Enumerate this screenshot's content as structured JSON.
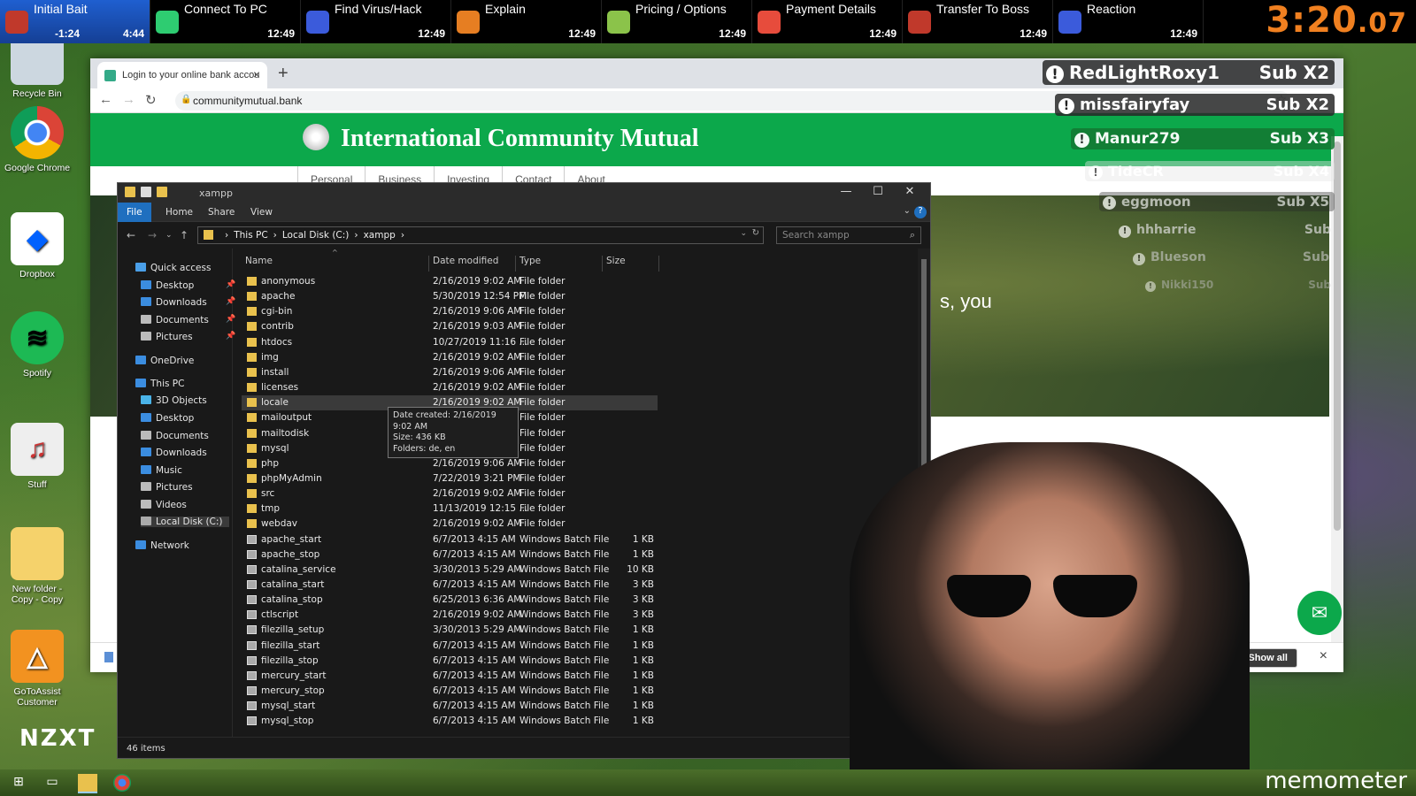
{
  "splits": [
    {
      "name": "Initial Bait",
      "delta": "-1:24",
      "time": "4:44",
      "active": true,
      "color": "#c0392b"
    },
    {
      "name": "Connect To PC",
      "time": "12:49",
      "color": "#2ecc71"
    },
    {
      "name": "Find Virus/Hack",
      "time": "12:49",
      "color": "#3b5bdb"
    },
    {
      "name": "Explain",
      "time": "12:49",
      "color": "#e67e22"
    },
    {
      "name": "Pricing / Options",
      "time": "12:49",
      "color": "#8bc34a"
    },
    {
      "name": "Payment Details",
      "time": "12:49",
      "color": "#e74c3c"
    },
    {
      "name": "Transfer To Boss",
      "time": "12:49",
      "color": "#c0392b"
    },
    {
      "name": "Reaction",
      "time": "12:49",
      "color": "#3b5bdb"
    }
  ],
  "timer": {
    "main": "3:20",
    "frac": ".07"
  },
  "desktop_icons": [
    {
      "label": "Recycle Bin"
    },
    {
      "label": "Google Chrome"
    },
    {
      "label": "Dropbox"
    },
    {
      "label": "Spotify"
    },
    {
      "label": "Stuff"
    },
    {
      "label": "New folder - Copy - Copy"
    },
    {
      "label": "GoToAssist Customer"
    }
  ],
  "nzxt": "NZXT",
  "browser": {
    "tab_title": "Login to your online bank accou",
    "url": "communitymutual.bank",
    "site_title": "International Community Mutual",
    "nav": [
      "Personal",
      "Business",
      "Investing",
      "Contact",
      "About"
    ],
    "hero_text": "s, you",
    "show_all": "Show all"
  },
  "explorer": {
    "title": "xampp",
    "ribbon": [
      "File",
      "Home",
      "Share",
      "View"
    ],
    "path": [
      "This PC",
      "Local Disk (C:)",
      "xampp"
    ],
    "search_placeholder": "Search xampp",
    "nav_pane": [
      {
        "label": "Quick access",
        "icon": "star-icon",
        "level": 0
      },
      {
        "label": "Desktop",
        "icon": "desktop-icon",
        "level": 1,
        "pinned": true
      },
      {
        "label": "Downloads",
        "icon": "download-icon",
        "level": 1,
        "pinned": true
      },
      {
        "label": "Documents",
        "icon": "documents-icon",
        "level": 1,
        "pinned": true
      },
      {
        "label": "Pictures",
        "icon": "pictures-icon",
        "level": 1,
        "pinned": true
      },
      {
        "label": "OneDrive",
        "icon": "cloud-icon",
        "level": 0
      },
      {
        "label": "This PC",
        "icon": "computer-icon",
        "level": 0
      },
      {
        "label": "3D Objects",
        "icon": "cube-icon",
        "level": 1
      },
      {
        "label": "Desktop",
        "icon": "desktop-icon",
        "level": 1
      },
      {
        "label": "Documents",
        "icon": "documents-icon",
        "level": 1
      },
      {
        "label": "Downloads",
        "icon": "download-icon",
        "level": 1
      },
      {
        "label": "Music",
        "icon": "music-icon",
        "level": 1
      },
      {
        "label": "Pictures",
        "icon": "pictures-icon",
        "level": 1
      },
      {
        "label": "Videos",
        "icon": "video-icon",
        "level": 1
      },
      {
        "label": "Local Disk (C:)",
        "icon": "drive-icon",
        "level": 1,
        "selected": true
      },
      {
        "label": "Network",
        "icon": "network-icon",
        "level": 0
      }
    ],
    "columns": [
      "Name",
      "Date modified",
      "Type",
      "Size"
    ],
    "files": [
      {
        "name": "anonymous",
        "date": "2/16/2019 9:02 AM",
        "type": "File folder",
        "size": "",
        "kind": "folder"
      },
      {
        "name": "apache",
        "date": "5/30/2019 12:54 PM",
        "type": "File folder",
        "size": "",
        "kind": "folder"
      },
      {
        "name": "cgi-bin",
        "date": "2/16/2019 9:06 AM",
        "type": "File folder",
        "size": "",
        "kind": "folder"
      },
      {
        "name": "contrib",
        "date": "2/16/2019 9:03 AM",
        "type": "File folder",
        "size": "",
        "kind": "folder"
      },
      {
        "name": "htdocs",
        "date": "10/27/2019 11:16 ...",
        "type": "File folder",
        "size": "",
        "kind": "folder"
      },
      {
        "name": "img",
        "date": "2/16/2019 9:02 AM",
        "type": "File folder",
        "size": "",
        "kind": "folder"
      },
      {
        "name": "install",
        "date": "2/16/2019 9:06 AM",
        "type": "File folder",
        "size": "",
        "kind": "folder"
      },
      {
        "name": "licenses",
        "date": "2/16/2019 9:02 AM",
        "type": "File folder",
        "size": "",
        "kind": "folder"
      },
      {
        "name": "locale",
        "date": "2/16/2019 9:02 AM",
        "type": "File folder",
        "size": "",
        "kind": "folder",
        "hover": true
      },
      {
        "name": "mailoutput",
        "date": "",
        "type": "File folder",
        "size": "",
        "kind": "folder"
      },
      {
        "name": "mailtodisk",
        "date": "",
        "type": "File folder",
        "size": "",
        "kind": "folder"
      },
      {
        "name": "mysql",
        "date": "",
        "type": "File folder",
        "size": "",
        "kind": "folder"
      },
      {
        "name": "php",
        "date": "2/16/2019 9:06 AM",
        "type": "File folder",
        "size": "",
        "kind": "folder"
      },
      {
        "name": "phpMyAdmin",
        "date": "7/22/2019 3:21 PM",
        "type": "File folder",
        "size": "",
        "kind": "folder"
      },
      {
        "name": "src",
        "date": "2/16/2019 9:02 AM",
        "type": "File folder",
        "size": "",
        "kind": "folder"
      },
      {
        "name": "tmp",
        "date": "11/13/2019 12:15 ...",
        "type": "File folder",
        "size": "",
        "kind": "folder"
      },
      {
        "name": "webdav",
        "date": "2/16/2019 9:02 AM",
        "type": "File folder",
        "size": "",
        "kind": "folder"
      },
      {
        "name": "apache_start",
        "date": "6/7/2013 4:15 AM",
        "type": "Windows Batch File",
        "size": "1 KB",
        "kind": "batch"
      },
      {
        "name": "apache_stop",
        "date": "6/7/2013 4:15 AM",
        "type": "Windows Batch File",
        "size": "1 KB",
        "kind": "batch"
      },
      {
        "name": "catalina_service",
        "date": "3/30/2013 5:29 AM",
        "type": "Windows Batch File",
        "size": "10 KB",
        "kind": "batch"
      },
      {
        "name": "catalina_start",
        "date": "6/7/2013 4:15 AM",
        "type": "Windows Batch File",
        "size": "3 KB",
        "kind": "batch"
      },
      {
        "name": "catalina_stop",
        "date": "6/25/2013 6:36 AM",
        "type": "Windows Batch File",
        "size": "3 KB",
        "kind": "batch"
      },
      {
        "name": "ctlscript",
        "date": "2/16/2019 9:02 AM",
        "type": "Windows Batch File",
        "size": "3 KB",
        "kind": "batch"
      },
      {
        "name": "filezilla_setup",
        "date": "3/30/2013 5:29 AM",
        "type": "Windows Batch File",
        "size": "1 KB",
        "kind": "batch"
      },
      {
        "name": "filezilla_start",
        "date": "6/7/2013 4:15 AM",
        "type": "Windows Batch File",
        "size": "1 KB",
        "kind": "batch"
      },
      {
        "name": "filezilla_stop",
        "date": "6/7/2013 4:15 AM",
        "type": "Windows Batch File",
        "size": "1 KB",
        "kind": "batch"
      },
      {
        "name": "mercury_start",
        "date": "6/7/2013 4:15 AM",
        "type": "Windows Batch File",
        "size": "1 KB",
        "kind": "batch"
      },
      {
        "name": "mercury_stop",
        "date": "6/7/2013 4:15 AM",
        "type": "Windows Batch File",
        "size": "1 KB",
        "kind": "batch"
      },
      {
        "name": "mysql_start",
        "date": "6/7/2013 4:15 AM",
        "type": "Windows Batch File",
        "size": "1 KB",
        "kind": "batch"
      },
      {
        "name": "mysql_stop",
        "date": "6/7/2013 4:15 AM",
        "type": "Windows Batch File",
        "size": "1 KB",
        "kind": "batch"
      }
    ],
    "tooltip": [
      "Date created: 2/16/2019 9:02 AM",
      "Size: 436 KB",
      "Folders: de, en"
    ],
    "status": "46 items"
  },
  "chat": [
    {
      "user": "RedLightRoxy1",
      "sub": "Sub X2"
    },
    {
      "user": "missfairyfay",
      "sub": "Sub X2"
    },
    {
      "user": "Manur279",
      "sub": "Sub X3"
    },
    {
      "user": "TideCR",
      "sub": "Sub X4"
    },
    {
      "user": "eggmoon",
      "sub": "Sub X5"
    },
    {
      "user": "hhharrie",
      "sub": "Sub"
    },
    {
      "user": "Blueson",
      "sub": "Sub"
    },
    {
      "user": "Nikki150",
      "sub": "Sub"
    }
  ],
  "watermark": "memometer"
}
